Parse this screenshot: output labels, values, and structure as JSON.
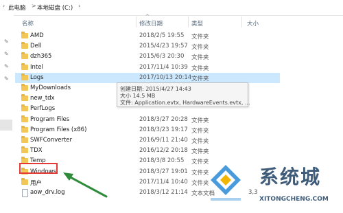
{
  "breadcrumb": {
    "parts": [
      "此电脑",
      "本地磁盘 (C:)"
    ],
    "separator": ">"
  },
  "columns": {
    "name": "名称",
    "date": "修改日期",
    "type": "类型",
    "size": "大小"
  },
  "rows": [
    {
      "name": "AMD",
      "date": "2018/2/5 19:55",
      "type": "文件夹",
      "size": "",
      "kind": "folder"
    },
    {
      "name": "Dell",
      "date": "2015/4/23 19:57",
      "type": "文件夹",
      "size": "",
      "kind": "folder"
    },
    {
      "name": "dzh365",
      "date": "2015/6/3 20:30",
      "type": "文件夹",
      "size": "",
      "kind": "folder"
    },
    {
      "name": "Intel",
      "date": "2017/11/4 10:39",
      "type": "文件夹",
      "size": "",
      "kind": "folder"
    },
    {
      "name": "Logs",
      "date": "2017/10/13 20:14",
      "type": "文件夹",
      "size": "",
      "kind": "folder",
      "selected": true
    },
    {
      "name": "MyDownloads",
      "date": "",
      "type": "",
      "size": "",
      "kind": "folder"
    },
    {
      "name": "new_tdx",
      "date": "",
      "type": "",
      "size": "",
      "kind": "folder"
    },
    {
      "name": "PerfLogs",
      "date": "",
      "type": "",
      "size": "",
      "kind": "folder"
    },
    {
      "name": "Program Files",
      "date": "2018/3/27 20:28",
      "type": "文件夹",
      "size": "",
      "kind": "folder"
    },
    {
      "name": "Program Files (x86)",
      "date": "2018/3/23 19:17",
      "type": "文件夹",
      "size": "",
      "kind": "folder"
    },
    {
      "name": "SWFConverter",
      "date": "2016/9/11 21:40",
      "type": "文件夹",
      "size": "",
      "kind": "folder"
    },
    {
      "name": "TDX",
      "date": "2016/12/2 20:18",
      "type": "文件夹",
      "size": "",
      "kind": "folder"
    },
    {
      "name": "Temp",
      "date": "2018/3/8 20:55",
      "type": "文件夹",
      "size": "",
      "kind": "folder"
    },
    {
      "name": "Windows",
      "date": "2018/3/27 19:01",
      "type": "文件夹",
      "size": "",
      "kind": "folder"
    },
    {
      "name": "用户",
      "date": "2017/11/4 10:40",
      "type": "文件夹",
      "size": "",
      "kind": "folder"
    },
    {
      "name": "aow_drv.log",
      "date": "2018/3/12 21:14",
      "type": "文本文档",
      "size": "3,3",
      "kind": "file"
    }
  ],
  "tooltip": {
    "line1": "创建日期: 2015/4/27 14:43",
    "line2": "大小 14.5 MB",
    "line3": "文件: Application.evtx, HardwareEvents.evtx, ..."
  },
  "watermark": {
    "text": "系统城",
    "url": "XITONGCHENG.COM"
  },
  "colors": {
    "selected_row": "#cce8ff",
    "folder": "#f3c658",
    "highlight_box": "#e53935",
    "arrow": "#2e8b3a",
    "watermark": "#3f5c7a"
  }
}
